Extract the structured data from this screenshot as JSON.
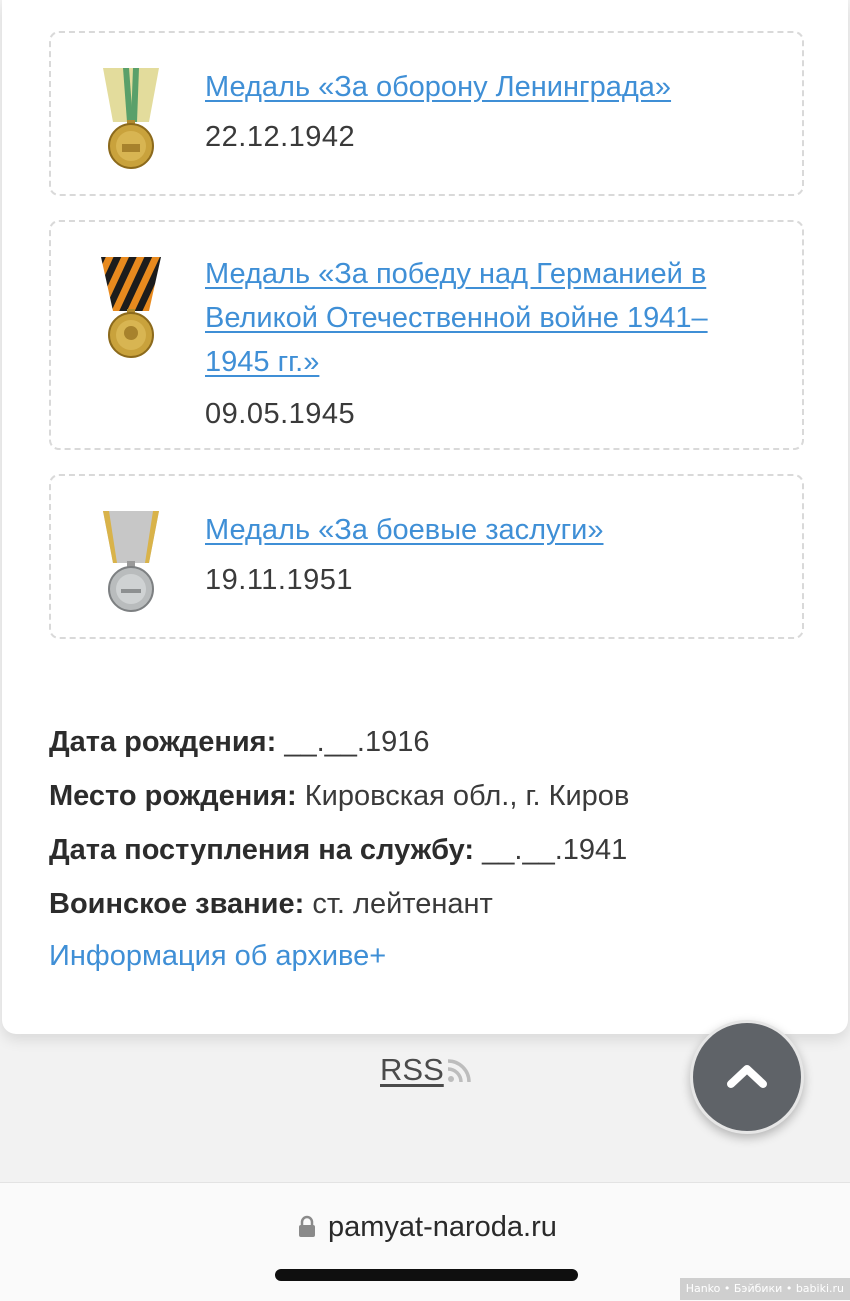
{
  "awards": [
    {
      "title": "Медаль «За оборону Ленинграда»",
      "date": "22.12.1942",
      "medal_icon": "leningrad-defense-medal-icon"
    },
    {
      "title": "Медаль «За победу над Германией в Великой Отечественной войне 1941–1945 гг.»",
      "date": "09.05.1945",
      "medal_icon": "victory-over-germany-medal-icon"
    },
    {
      "title": "Медаль «За боевые заслуги»",
      "date": "19.11.1951",
      "medal_icon": "combat-merit-medal-icon"
    }
  ],
  "info": {
    "birth_date": {
      "label": "Дата рождения:",
      "value": "__.__.1916"
    },
    "birth_place": {
      "label": "Место рождения:",
      "value": "Кировская обл., г. Киров"
    },
    "service_date": {
      "label": "Дата поступления на службу:",
      "value": "__.__.1941"
    },
    "rank": {
      "label": "Воинское звание:",
      "value": "ст. лейтенант"
    }
  },
  "archive_link": "Информация об архиве+",
  "footer": {
    "rss": "RSS"
  },
  "browser": {
    "url": "pamyat-naroda.ru"
  },
  "watermark": "Hanko • Бэйбики • babiki.ru",
  "colors": {
    "link": "#3f8fd6",
    "text": "#3a3a3a",
    "background": "#f2f2f2",
    "scroll_button": "#5f6368"
  }
}
